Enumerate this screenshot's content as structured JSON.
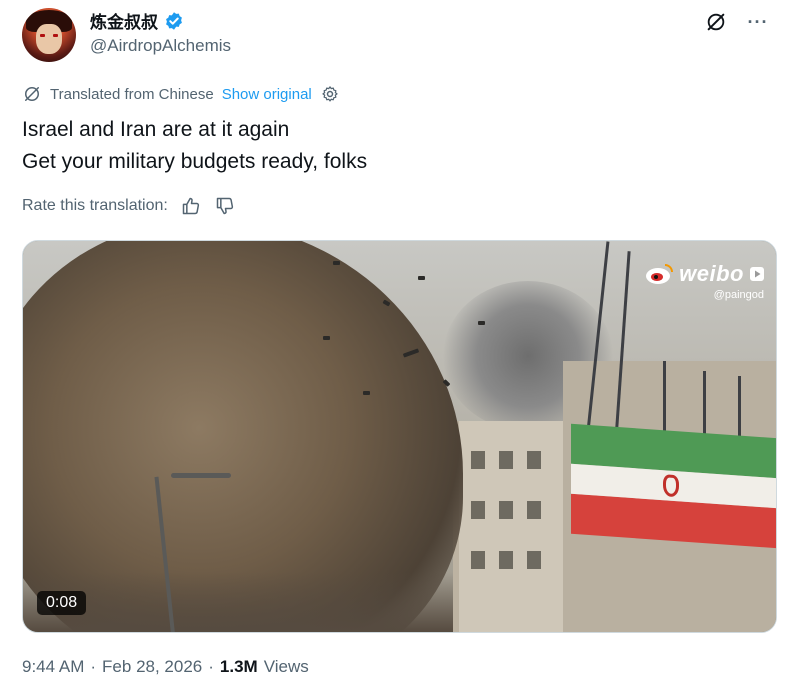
{
  "author": {
    "display_name": "炼金叔叔",
    "handle": "@AirdropAlchemis",
    "verified": true
  },
  "top_actions": {
    "icons": [
      "grok-icon",
      "more-icon"
    ],
    "more_label": "···"
  },
  "translation": {
    "label": "Translated from Chinese",
    "show_original": "Show original",
    "icons": [
      "translate-icon",
      "settings-icon"
    ]
  },
  "tweet": {
    "lines": [
      "Israel and Iran are at it again",
      "Get your military budgets ready, folks"
    ]
  },
  "rating": {
    "label": "Rate this translation:",
    "icons": [
      "thumbs-up-icon",
      "thumbs-down-icon"
    ]
  },
  "media": {
    "watermark_brand": "weibo",
    "watermark_user": "@paingod",
    "duration": "0:08"
  },
  "meta": {
    "time": "9:44 AM",
    "separator": "·",
    "date": "Feb 28, 2026",
    "views_count": "1.3M",
    "views_label": "Views"
  },
  "colors": {
    "link": "#1d9bf0",
    "secondary_text": "#536471",
    "primary_text": "#0f1419"
  }
}
